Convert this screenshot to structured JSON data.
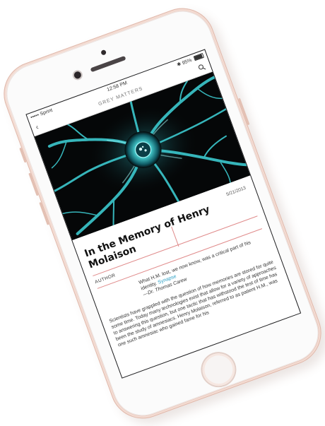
{
  "status_bar": {
    "carrier": "Sprint",
    "time": "12:58 PM",
    "battery": "95%",
    "battery_level": 0.95
  },
  "nav": {
    "title": "GREY MATTERS"
  },
  "article": {
    "title": "In the Memory of Henry Molaison",
    "date": "5/21/2013",
    "author_label": "AUTHOR",
    "quote_prefix": "What H.M. lost, we now know, was a critical part of his identity.",
    "quote_link": "Synapse",
    "quote_attribution": "—Dr. Thomas Carew",
    "body": "Scientists have grappled with the question of how memories are stored for quite some time. Today many technologies exist that allow for a variety of approaches to answering this question, but one tactic that has withstood the test of time has been the study of amnesiacs. Henry Molaison, referred to as patient H.M., was one such amnesiac who gained fame for his"
  },
  "colors": {
    "accent_rule": "#e08b8b",
    "link": "#2b9fc4",
    "phone_body": "#efd3c9",
    "neuron_glow": "#52e6e6"
  }
}
